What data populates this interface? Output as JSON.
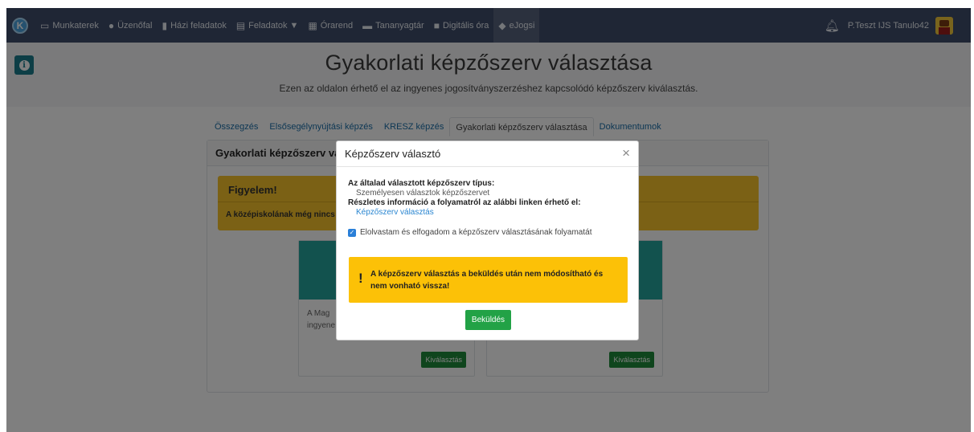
{
  "navbar": {
    "items": [
      {
        "label": "Munkaterek",
        "icon": "monitor-icon"
      },
      {
        "label": "Üzenőfal",
        "icon": "chat-bubble-icon"
      },
      {
        "label": "Házi feladatok",
        "icon": "file-icon"
      },
      {
        "label": "Feladatok ▼",
        "icon": "clipboard-icon"
      },
      {
        "label": "Órarend",
        "icon": "calendar-icon"
      },
      {
        "label": "Tananyagtár",
        "icon": "book-icon"
      },
      {
        "label": "Digitális óra",
        "icon": "video-camera-icon"
      },
      {
        "label": "eJogsi",
        "icon": "car-icon"
      }
    ],
    "user_name": "P.Teszt IJS Tanulo42"
  },
  "header": {
    "title": "Gyakorlati képzőszerv választása",
    "subtitle": "Ezen az oldalon érhető el az ingyenes jogosítványszerzéshez kapcsolódó képzőszerv kiválasztás."
  },
  "tabs": [
    {
      "label": "Összegzés"
    },
    {
      "label": "Elsősegélynyújtási képzés"
    },
    {
      "label": "KRESZ képzés"
    },
    {
      "label": "Gyakorlati képzőszerv választása"
    },
    {
      "label": "Dokumentumok"
    }
  ],
  "card": {
    "title": "Gyakorlati képzőszerv vál",
    "alert_title": "Figyelem!",
    "alert_text": "A középiskolának még nincs",
    "option1_text_line1": "A Mag",
    "option1_text_line2": "ingyene",
    "option_button": "Kiválasztás"
  },
  "modal": {
    "title": "Képzőszerv választó",
    "close": "×",
    "type_label": "Az általad választott képzőszerv típus:",
    "type_value": "Személyesen választok képzőszervet",
    "info_label": "Részletes információ a folyamatról az alábbi linken érhető el:",
    "info_link": "Képzőszerv választás",
    "checkbox_label": "Elolvastam és elfogadom a képzőszerv választásának folyamatát",
    "warning_icon": "!",
    "warning_text": "A képzőszerv választás a beküldés után nem módosítható és nem vonható vissza!",
    "submit_label": "Beküldés"
  }
}
